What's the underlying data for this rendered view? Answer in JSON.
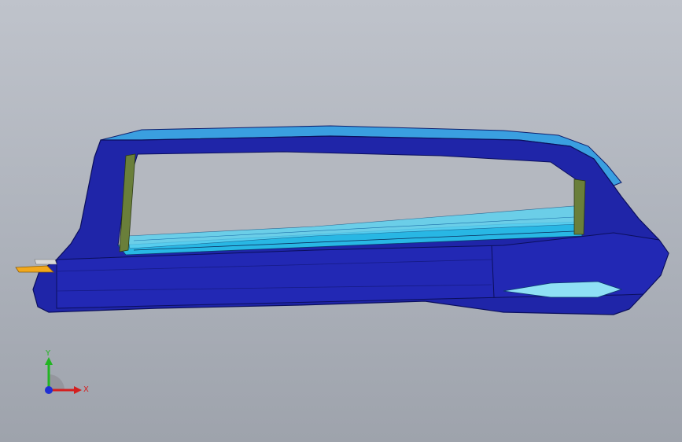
{
  "viewport": {
    "background_top": "#bfc3cb",
    "background_bottom": "#9ea3ac"
  },
  "model": {
    "body_color": "#1f25a8",
    "body_dark": "#0f136e",
    "rim_color": "#2f8fd6",
    "inner_color": "#28b7e4",
    "bracket_color": "#6a7f3a",
    "tab_color": "#f2a81c"
  },
  "triad": {
    "x_label": "X",
    "y_label": "Y",
    "x_color": "#d41f1f",
    "y_color": "#22b522",
    "z_color": "#1f2fd4"
  }
}
